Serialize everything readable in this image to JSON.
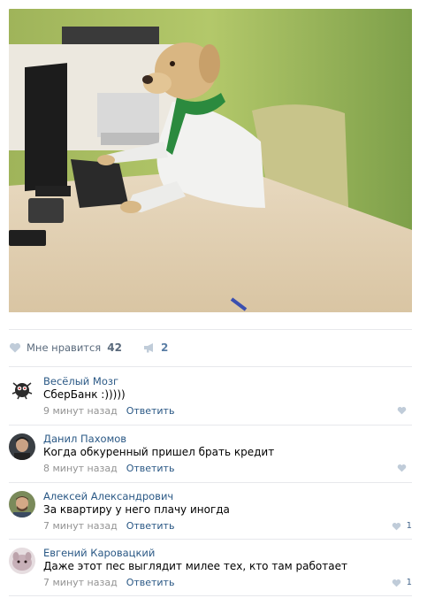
{
  "post": {
    "photo_alt": "photo",
    "likes": {
      "label": "Мне нравится",
      "count": "42"
    },
    "shares": {
      "count": "2"
    }
  },
  "comments": [
    {
      "author": "Весёлый Мозг",
      "text": "СберБанк :)))))",
      "time": "9 минут назад",
      "reply": "Ответить",
      "likes": ""
    },
    {
      "author": "Данил Пахомов",
      "text": "Когда обкуренный пришел брать кредит",
      "time": "8 минут назад",
      "reply": "Ответить",
      "likes": ""
    },
    {
      "author": "Алексей Александрович",
      "text": "За квартиру у него плачу иногда",
      "time": "7 минут назад",
      "reply": "Ответить",
      "likes": "1"
    },
    {
      "author": "Евгений Каровацкий",
      "text": "Даже этот пес выглядит милее тех, кто там работает",
      "time": "7 минут назад",
      "reply": "Ответить",
      "likes": "1"
    }
  ],
  "colors": {
    "link": "#2a5885",
    "muted": "#939393",
    "heart": "#c0ccd9"
  },
  "icons": {
    "like": "heart-icon",
    "share": "megaphone-icon"
  }
}
